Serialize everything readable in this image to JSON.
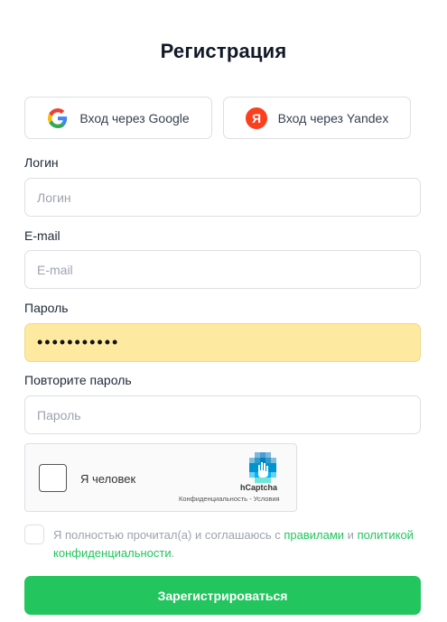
{
  "page": {
    "title": "Регистрация"
  },
  "social": {
    "google_label": "Вход через Google",
    "yandex_label": "Вход через Yandex",
    "yandex_letter": "Я"
  },
  "fields": {
    "login": {
      "label": "Логин",
      "placeholder": "Логин",
      "value": ""
    },
    "email": {
      "label": "E-mail",
      "placeholder": "E-mail",
      "value": ""
    },
    "password": {
      "label": "Пароль",
      "value": "•••••••••••"
    },
    "password_repeat": {
      "label": "Повторите пароль",
      "placeholder": "Пароль",
      "value": ""
    }
  },
  "captcha": {
    "checkbox_label": "Я человек",
    "brand": "hCaptcha",
    "links": "Конфиденциальность - Условия"
  },
  "agreement": {
    "text_before": "Я полностью прочитал(а) и соглашаюсь с ",
    "rules_link": "правилами",
    "and": " и ",
    "privacy_link": "политикой конфиденциальности",
    "end": "."
  },
  "submit_label": "Зарегистрироваться",
  "colors": {
    "accent": "#22c55e",
    "autofill": "#fde9a0",
    "yandex": "#fc3f1d"
  }
}
